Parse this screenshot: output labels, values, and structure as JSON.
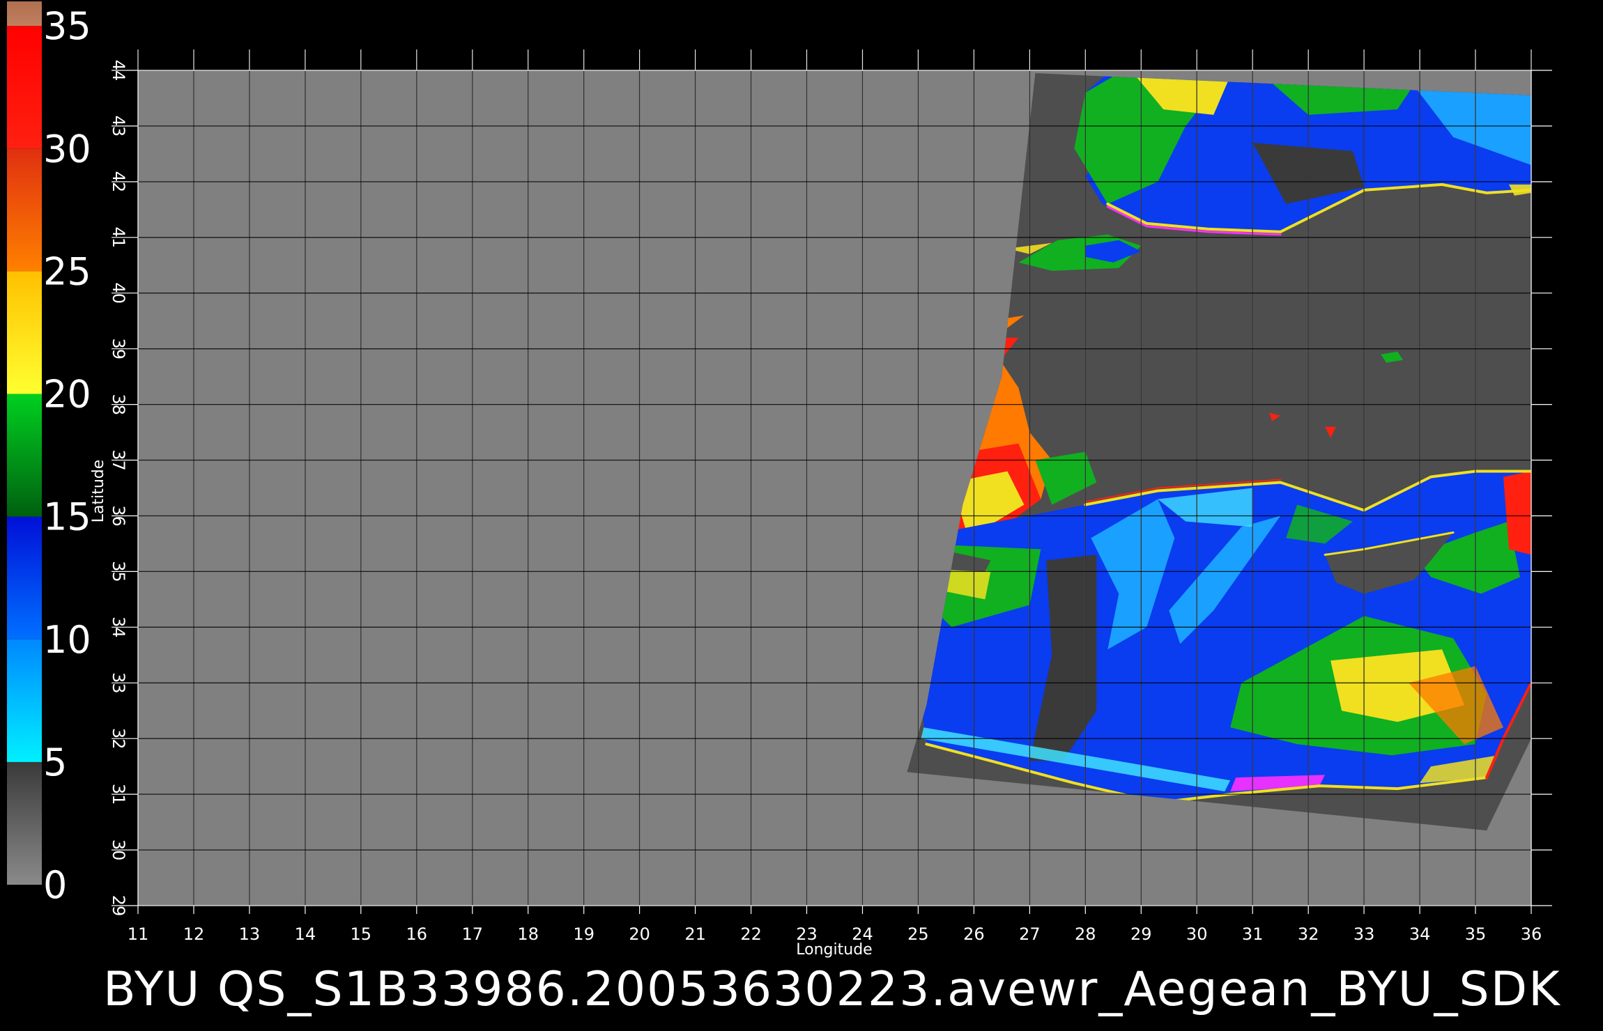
{
  "colorbar": {
    "ticks": [
      "0",
      "5",
      "10",
      "15",
      "20",
      "25",
      "30",
      "35"
    ],
    "range": [
      0,
      36
    ],
    "segments": [
      {
        "from": 0,
        "to": 5,
        "c0": "#8a8a8a",
        "c1": "#3a3a3a"
      },
      {
        "from": 5,
        "to": 10,
        "c0": "#00f0ff",
        "c1": "#0088ff"
      },
      {
        "from": 10,
        "to": 15,
        "c0": "#0070ff",
        "c1": "#0010d8"
      },
      {
        "from": 15,
        "to": 20,
        "c0": "#006010",
        "c1": "#00d020"
      },
      {
        "from": 20,
        "to": 25,
        "c0": "#ffff30",
        "c1": "#ffc000"
      },
      {
        "from": 25,
        "to": 30,
        "c0": "#ff8000",
        "c1": "#e03010"
      },
      {
        "from": 30,
        "to": 35,
        "c0": "#ff2010",
        "c1": "#ff0000"
      },
      {
        "from": 35,
        "to": 36,
        "c0": "#c08060",
        "c1": "#b07050"
      }
    ]
  },
  "map": {
    "lon_range": [
      11,
      36
    ],
    "lat_range": [
      29,
      44
    ],
    "lon_ticks": [
      "11",
      "12",
      "13",
      "14",
      "15",
      "16",
      "17",
      "18",
      "19",
      "20",
      "21",
      "22",
      "23",
      "24",
      "25",
      "26",
      "27",
      "28",
      "29",
      "30",
      "31",
      "32",
      "33",
      "34",
      "35",
      "36"
    ],
    "lat_ticks": [
      "29",
      "30",
      "31",
      "32",
      "33",
      "34",
      "35",
      "36",
      "37",
      "38",
      "39",
      "40",
      "41",
      "42",
      "43",
      "44"
    ],
    "xlabel": "Longitude",
    "ylabel": "Latitude",
    "colors": {
      "background": "#000000",
      "land": "#808080",
      "swath": "#4e4e4e",
      "grid": "#000000",
      "low_wind": "#3a3a3a",
      "blue": "#0a3cf0",
      "light_blue": "#1aa0ff",
      "cyan": "#40e0ff",
      "green": "#10b020",
      "yellow": "#f0e020",
      "orange": "#ff7a00",
      "red": "#ff2010",
      "magenta": "#ff30ff"
    }
  },
  "caption": "BYU  QS_S1B33986.20053630223.avewr_Aegean_BYU_SDK"
}
